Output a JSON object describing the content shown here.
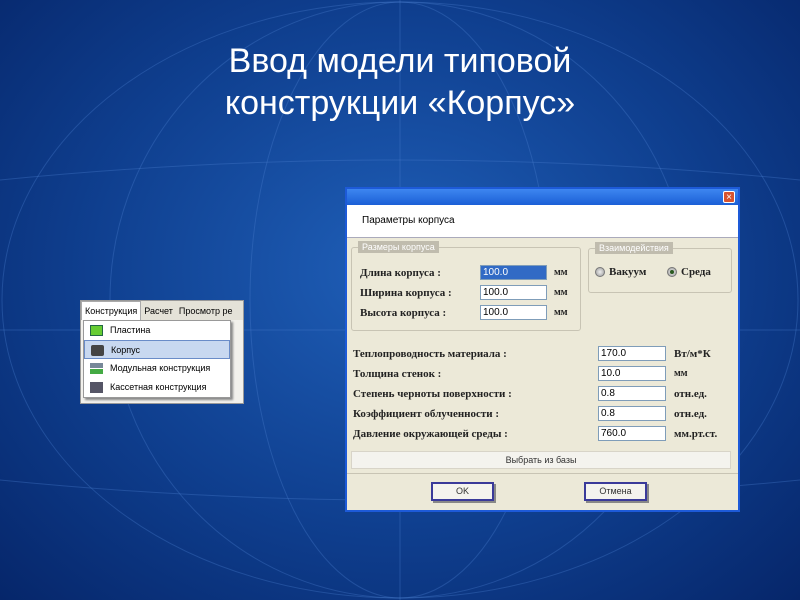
{
  "slide_title_line1": "Ввод модели типовой",
  "slide_title_line2": "конструкции «Корпус»",
  "menu": {
    "tabs": [
      "Конструкция",
      "Расчет",
      "Просмотр ре"
    ],
    "items": [
      "Пластина",
      "Корпус",
      "Модульная конструкция",
      "Кассетная конструкция"
    ]
  },
  "dialog": {
    "close": "×",
    "header": "Параметры корпуса",
    "size_group": {
      "legend": "Размеры корпуса",
      "rows": [
        {
          "label": "Длина корпуса :",
          "value": "100.0",
          "unit": "мм"
        },
        {
          "label": "Ширина корпуса :",
          "value": "100.0",
          "unit": "мм"
        },
        {
          "label": "Высота корпуса :",
          "value": "100.0",
          "unit": "мм"
        }
      ]
    },
    "interaction_group": {
      "legend": "Взаимодействия",
      "options": [
        "Вакуум",
        "Среда"
      ],
      "selected": "Среда"
    },
    "params": [
      {
        "label": "Теплопроводность материала :",
        "value": "170.0",
        "unit": "Вт/м*К"
      },
      {
        "label": "Толщина стенок :",
        "value": "10.0",
        "unit": "мм"
      },
      {
        "label": "Степень черноты поверхности :",
        "value": "0.8",
        "unit": "отн.ед."
      },
      {
        "label": "Коэффициент облученности :",
        "value": "0.8",
        "unit": "отн.ед."
      },
      {
        "label": "Давление окружающей среды :",
        "value": "760.0",
        "unit": "мм.рт.ст."
      }
    ],
    "db_button": "Выбрать из базы",
    "ok": "OK",
    "cancel": "Отмена"
  }
}
